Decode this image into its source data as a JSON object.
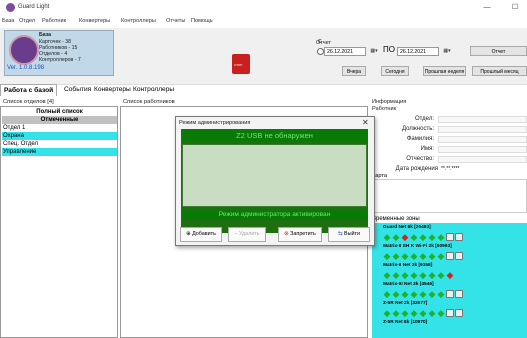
{
  "window": {
    "title": "Guard Light",
    "min": "—",
    "max": "☐"
  },
  "menu": [
    "База",
    "Отдел",
    "Работник",
    "Конвертеры",
    "Контроллеры",
    "Отчеты",
    "Помощь"
  ],
  "stats": {
    "title": "База",
    "cards": "Карточек - 38",
    "workers": "Работников - 15",
    "depts": "Отделов - 4",
    "controllers": "Контроллеров - 7",
    "version": "Ver. 1.0.8.198"
  },
  "report": {
    "label": "Отчет",
    "from_prefix": "С",
    "from_date": "26.12.2021",
    "to_prefix": "ПО",
    "to_date": "26.12.2021",
    "dropdown_glyph": "▦▾",
    "report_btn": "Отчет",
    "yesterday_btn": "Вчера",
    "today_btn": "Сегодня",
    "lastweek_btn": "Прошлая неделя",
    "lastmonth_btn": "Прошлый месяц"
  },
  "device": {
    "label": "СТОП"
  },
  "tabs": [
    "Работа с базой",
    "События",
    "Конвертеры",
    "Контроллеры"
  ],
  "dept_list": {
    "header": "Список отделов [4]",
    "full": "Полный список",
    "marked": "Отмеченные",
    "items": [
      "Отдел 1",
      "Охрана",
      "Спец. Отдел",
      "Управление"
    ]
  },
  "employees_header": "Список работников",
  "info": {
    "header": "Информация",
    "sub": "Работник",
    "fields": [
      "Отдел:",
      "Должность:",
      "Фамилия:",
      "Имя:",
      "Отчество:",
      "Дата рождения"
    ],
    "birth_value": "**.**.****",
    "map_label": "Карта"
  },
  "zones": {
    "header": "Временные зоны",
    "items": [
      {
        "name": "Guard Net 8k [20483]",
        "states": [
          "g",
          "g",
          "r",
          "g",
          "g",
          "g",
          "g",
          "sq",
          "sq"
        ]
      },
      {
        "name": "Matrix-II EH K Wi-Fi 2k [50993]",
        "states": [
          "g",
          "g",
          "g",
          "g",
          "g",
          "g",
          "g",
          "sq",
          "sq"
        ]
      },
      {
        "name": "Matrix-II Net 2k [9158]",
        "states": [
          "g",
          "g",
          "g",
          "g",
          "g",
          "g",
          "g",
          "r"
        ]
      },
      {
        "name": "Matrix-III Net 2k [4546]",
        "states": [
          "g",
          "g",
          "g",
          "g",
          "g",
          "g",
          "g",
          "sq",
          "sq"
        ]
      },
      {
        "name": "Z-5R Net 2k [32077]",
        "states": [
          "g",
          "g",
          "g",
          "g",
          "g",
          "g",
          "g",
          "sq",
          "sq"
        ]
      },
      {
        "name": "Z-5R Net 8k [10970]",
        "states": []
      }
    ],
    "colors": {
      "green": "#1db22a",
      "red": "#d8201e"
    }
  },
  "modal": {
    "title": "Режим администрирования",
    "close": "✕",
    "banner_top": "Z2 USB не обнаружен",
    "banner_bottom": "Режим администратора активирован",
    "btn_add": "Добавить",
    "btn_delete": "Удалить",
    "btn_block": "Запретить",
    "btn_exit": "Выйти"
  }
}
